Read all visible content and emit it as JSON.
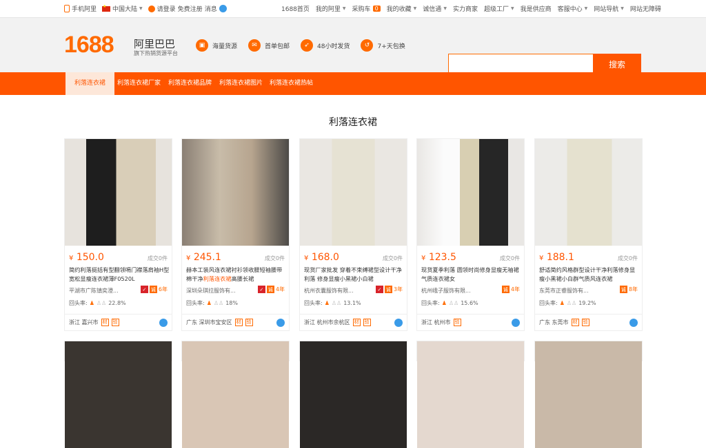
{
  "topbar": {
    "mobile": "手机阿里",
    "region": "中国大陆",
    "login": "请登录",
    "register": "免费注册",
    "messages": "消息",
    "links": [
      "1688首页",
      "我的阿里",
      "采购车",
      "我的收藏",
      "诚信通",
      "实力商家",
      "超级工厂",
      "我是供应商",
      "客服中心",
      "网站导航",
      "网站无障碍"
    ],
    "cart_count": "0"
  },
  "header": {
    "logo_number": "1688",
    "logo_name": "阿里巴巴",
    "logo_sub": "旗下热销货源平台",
    "features": [
      {
        "icon": "box-icon",
        "label": "海量货源"
      },
      {
        "icon": "package-icon",
        "label": "首单包邮"
      },
      {
        "icon": "rocket-icon",
        "label": "48小时发货"
      },
      {
        "icon": "return-icon",
        "label": "7+天包换"
      }
    ],
    "search_placeholder": "",
    "search_button": "搜索"
  },
  "nav": {
    "items": [
      "利落连衣裙",
      "利落连衣裙厂家",
      "利落连衣裙品牌",
      "利落连衣裙图片",
      "利落连衣裙热帖"
    ]
  },
  "section_title": "利落连衣裙",
  "products": [
    {
      "price": "150.0",
      "deals": "成交0件",
      "title_pre": "简约利落挺括有型翻领嗝门襟落肩袖H型宽松显瘦连衣裙薄F0520L",
      "title_hl": "",
      "title_post": "",
      "shop": "平湖市广陈镇奕澄...",
      "years": "6年",
      "repeat_label": "回头率:",
      "repeat": "22.8%",
      "location": "浙江 嘉兴市"
    },
    {
      "price": "245.1",
      "deals": "成交0件",
      "title_pre": "赫本工装风连衣裙衬衫领收腰短袖腰带棉干净",
      "title_hl": "利落连衣裙",
      "title_post": "高腰长裙",
      "shop": "深圳朵琪拉服饰有...",
      "years": "4年",
      "repeat_label": "回头率:",
      "repeat": "18%",
      "location": "广东 深圳市宝安区"
    },
    {
      "price": "168.0",
      "deals": "成交0件",
      "title_pre": "现货厂家批发 穿着不束缚裙型设计干净利落 修身显瘦小黑裙小白裙",
      "title_hl": "",
      "title_post": "",
      "shop": "杭州衣囊服饰有限...",
      "years": "3年",
      "repeat_label": "回头率:",
      "repeat": "13.1%",
      "location": "浙江 杭州市余杭区"
    },
    {
      "price": "123.5",
      "deals": "成交0件",
      "title_pre": "现货夏季利落 圆领时尚修身显瘦无袖裙气质连衣裙女",
      "title_hl": "",
      "title_post": "",
      "shop": "杭州峨子服饰有限...",
      "years": "4年",
      "repeat_label": "回头率:",
      "repeat": "15.6%",
      "location": "浙江 杭州市"
    },
    {
      "price": "188.1",
      "deals": "成交0件",
      "title_pre": "舒适简约风格群型设计干净利落修身显瘦小黑裙小白群气质风连衣裙",
      "title_hl": "",
      "title_post": "",
      "shop": "东莞市正睿服饰有...",
      "years": "8年",
      "repeat_label": "回头率:",
      "repeat": "19.2%",
      "location": "广东 东莞市"
    }
  ],
  "colors": {
    "accent": "#ff5500",
    "brand": "#ff6a00"
  }
}
